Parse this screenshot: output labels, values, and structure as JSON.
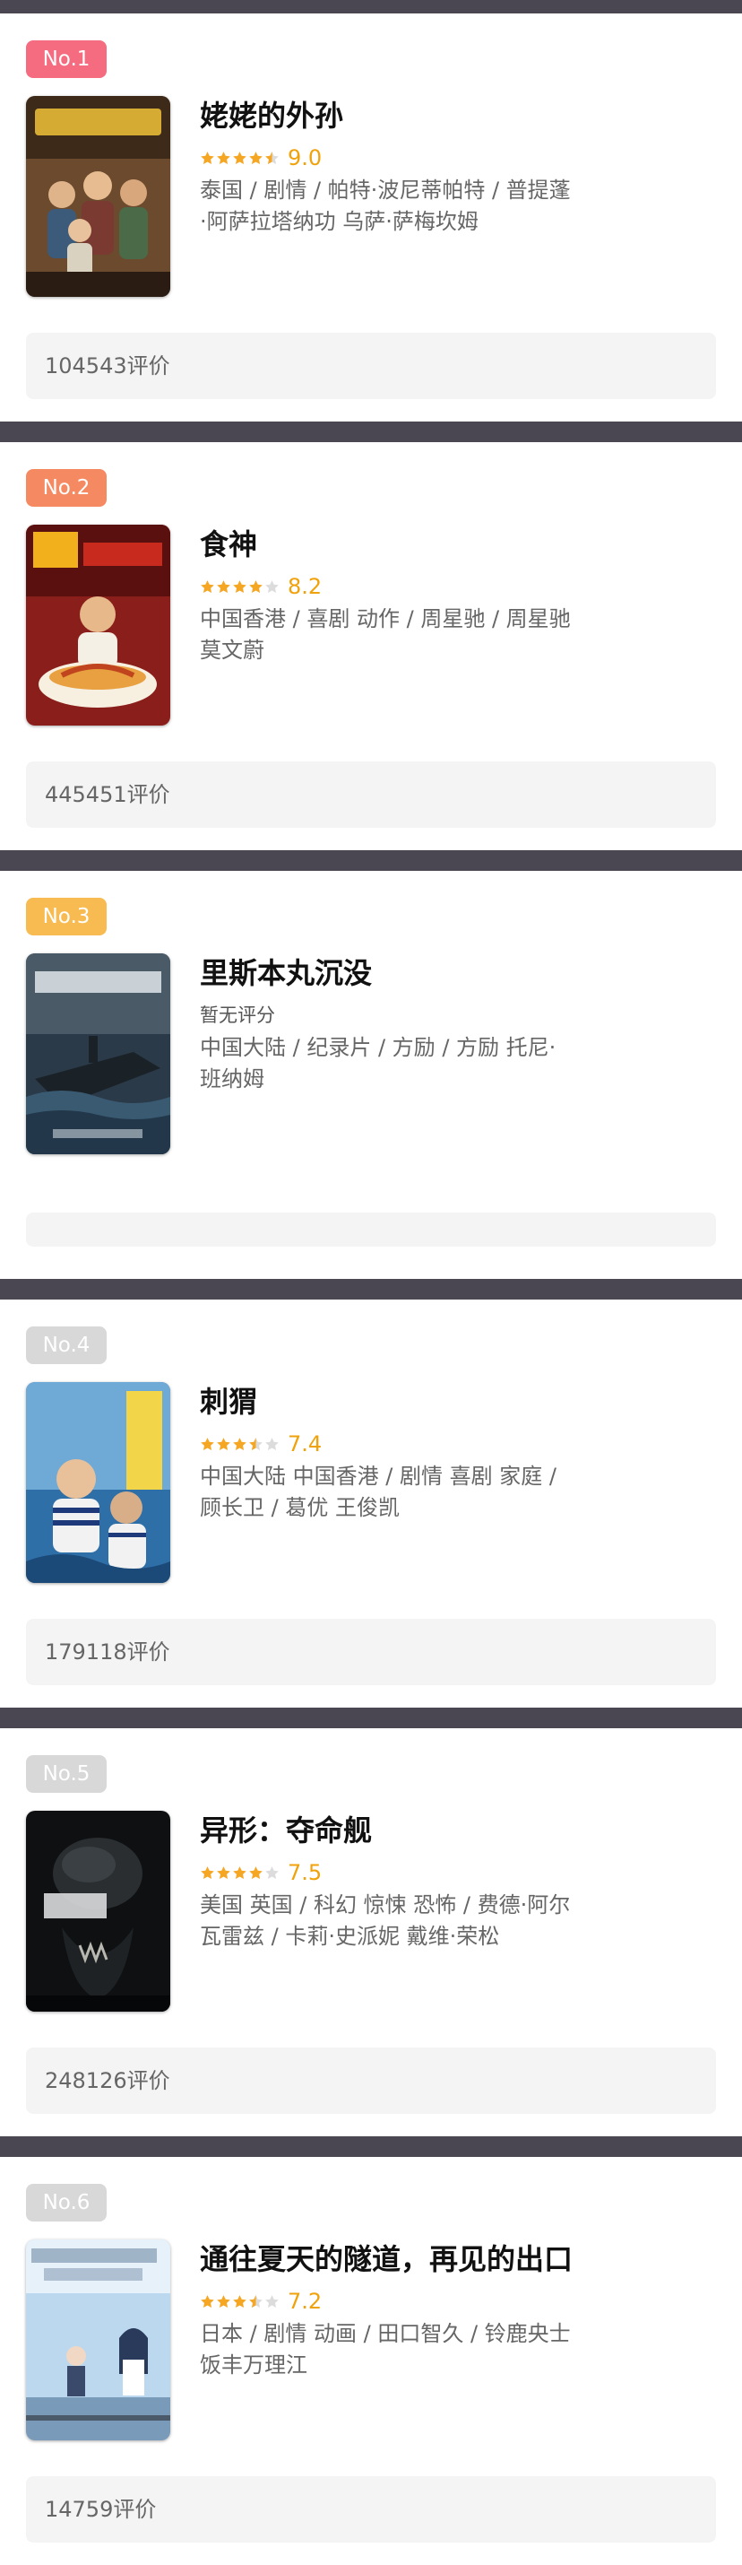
{
  "colors": {
    "badge_1": "#f56b80",
    "badge_2": "#f58a62",
    "badge_3": "#f8bb52",
    "badge_rest": "#d8d8d8",
    "star_on": "#f5a623",
    "star_off": "#dcdcdc",
    "score": "#f0a20c"
  },
  "movies": [
    {
      "rank_label": "No.1",
      "title": "姥姥的外孙",
      "stars": 4.5,
      "score": "9.0",
      "info_line_1": "泰国 / 剧情 / 帕特·波尼蒂帕特 / 普提蓬",
      "info_line_2": "·阿萨拉塔纳功 乌萨·萨梅坎姆",
      "reviews": "104543评价",
      "poster_icon": "movie-poster-family-portrait"
    },
    {
      "rank_label": "No.2",
      "title": "食神",
      "stars": 4,
      "score": "8.2",
      "info_line_1": "中国香港 / 喜剧 动作 / 周星驰 / 周星驰",
      "info_line_2": "莫文蔚",
      "reviews": "445451评价",
      "poster_icon": "movie-poster-noodle-bowl"
    },
    {
      "rank_label": "No.3",
      "title": "里斯本丸沉没",
      "no_score_text": "暂无评分",
      "info_line_1": "中国大陆 / 纪录片 / 方励 / 方励 托尼·",
      "info_line_2": "班纳姆",
      "reviews": "",
      "poster_icon": "movie-poster-sinking-ship"
    },
    {
      "rank_label": "No.4",
      "title": "刺猬",
      "stars": 3.5,
      "score": "7.4",
      "info_line_1": "中国大陆 中国香港 / 剧情 喜剧 家庭 /",
      "info_line_2": "顾长卫 / 葛优 王俊凯",
      "reviews": "179118评价",
      "poster_icon": "movie-poster-two-men-sky"
    },
    {
      "rank_label": "No.5",
      "title": "异形：夺命舰",
      "stars": 4,
      "score": "7.5",
      "info_line_1": "美国 英国 / 科幻 惊悚 恐怖 / 费德·阿尔",
      "info_line_2": "瓦雷兹 / 卡莉·史派妮 戴维·荣松",
      "reviews": "248126评价",
      "poster_icon": "movie-poster-alien-creature"
    },
    {
      "rank_label": "No.6",
      "title": "通往夏天的隧道，再见的出口",
      "stars": 3.5,
      "score": "7.2",
      "info_line_1": "日本 / 剧情 动画 / 田口智久 / 铃鹿央士",
      "info_line_2": "饭丰万理江",
      "reviews": "14759评价",
      "poster_icon": "movie-poster-anime-station"
    }
  ]
}
